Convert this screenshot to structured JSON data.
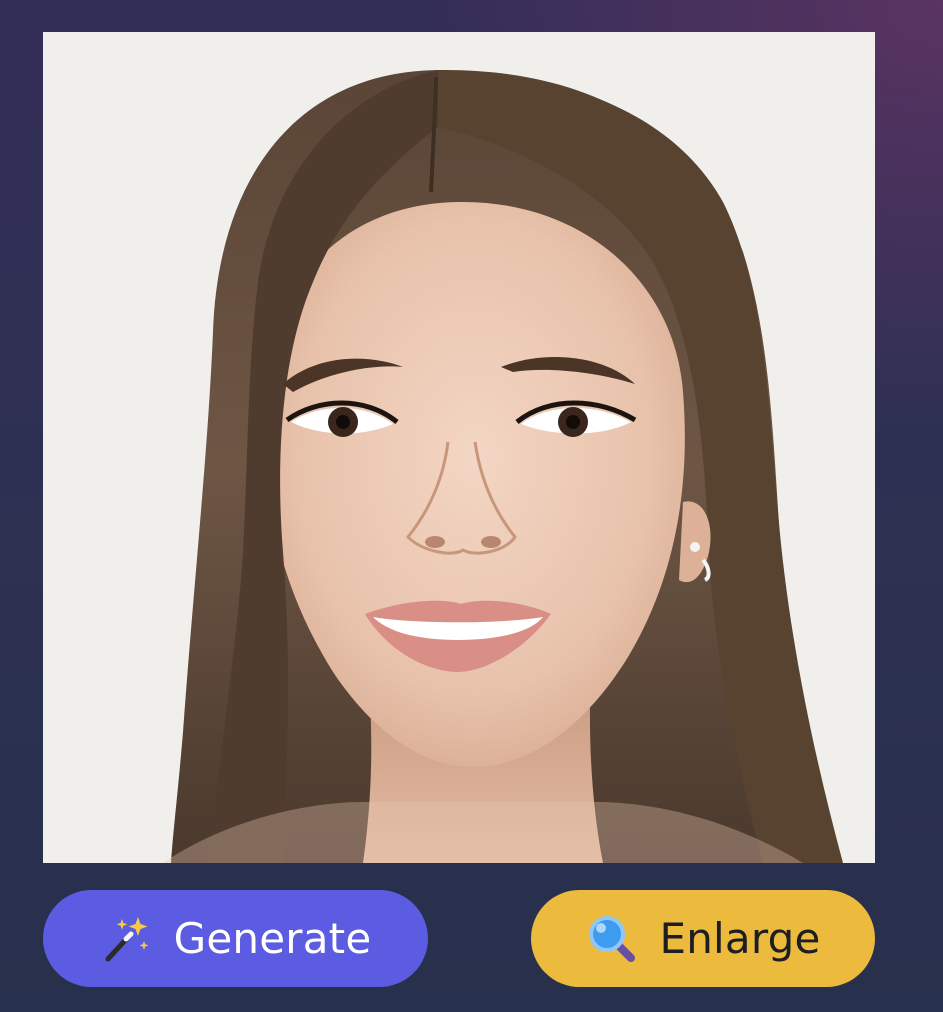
{
  "photo": {
    "subject": "portrait-photo",
    "background_color": "#f0efec"
  },
  "actions": {
    "generate": {
      "label": "Generate",
      "icon": "magic-wand-icon",
      "color": "#5b5ce2",
      "text_color": "#ffffff"
    },
    "enlarge": {
      "label": "Enlarge",
      "icon": "magnifying-glass-icon",
      "color": "#ecbb3d",
      "text_color": "#1d1d24"
    }
  },
  "theme": {
    "background_top": "#332e58",
    "background_corner": "#5c3462",
    "background_bottom": "#27304c"
  }
}
